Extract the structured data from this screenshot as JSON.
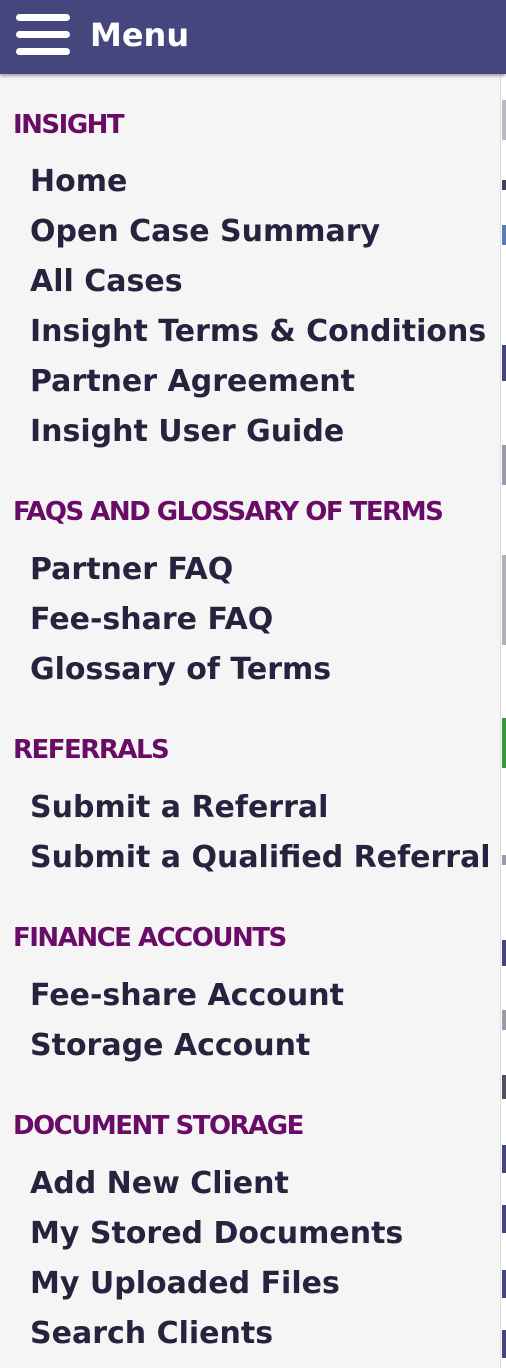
{
  "header": {
    "menu_icon": "hamburger-icon",
    "title": "Menu",
    "background_color": "#46467f"
  },
  "accent_color": "#6a0c67",
  "sections": [
    {
      "title": "INSIGHT",
      "items": [
        "Home",
        "Open Case Summary",
        "All Cases",
        "Insight Terms & Conditions",
        "Partner Agreement",
        "Insight User Guide"
      ]
    },
    {
      "title": "FAQS AND GLOSSARY OF TERMS",
      "items": [
        "Partner FAQ",
        "Fee-share FAQ",
        "Glossary of Terms"
      ]
    },
    {
      "title": "REFERRALS",
      "items": [
        "Submit a Referral",
        "Submit a Qualified Referral"
      ]
    },
    {
      "title": "FINANCE ACCOUNTS",
      "items": [
        "Fee-share Account",
        "Storage Account"
      ]
    },
    {
      "title": "DOCUMENT STORAGE",
      "items": [
        "Add New Client",
        "My Stored Documents",
        "My Uploaded Files",
        "Search Clients"
      ]
    }
  ]
}
